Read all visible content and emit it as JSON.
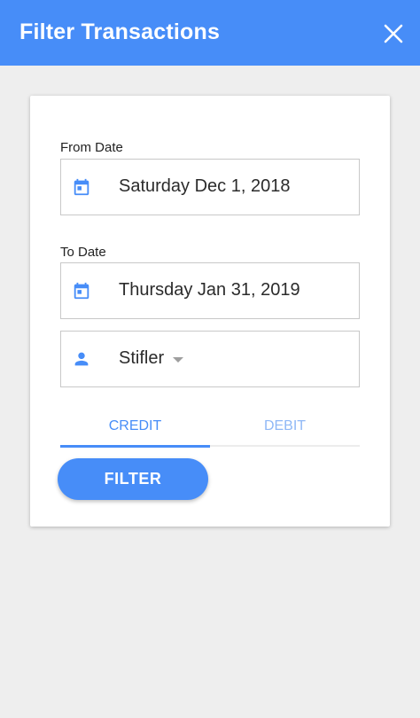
{
  "appbar": {
    "title": "Filter Transactions",
    "close_icon": "close-icon"
  },
  "form": {
    "from_date": {
      "label": "From Date",
      "value": "Saturday Dec 1, 2018",
      "icon": "calendar-icon"
    },
    "to_date": {
      "label": "To Date",
      "value": "Thursday Jan 31, 2019",
      "icon": "calendar-icon"
    },
    "person": {
      "value": "Stifler",
      "icon": "person-icon"
    },
    "tabs": [
      {
        "label": "CREDIT",
        "selected": true
      },
      {
        "label": "DEBIT",
        "selected": false
      }
    ],
    "filter_label": "FILTER"
  },
  "colors": {
    "primary": "#478df8",
    "background": "#eeeeee",
    "card": "#ffffff",
    "inactive_tab": "#8fb8f6"
  }
}
